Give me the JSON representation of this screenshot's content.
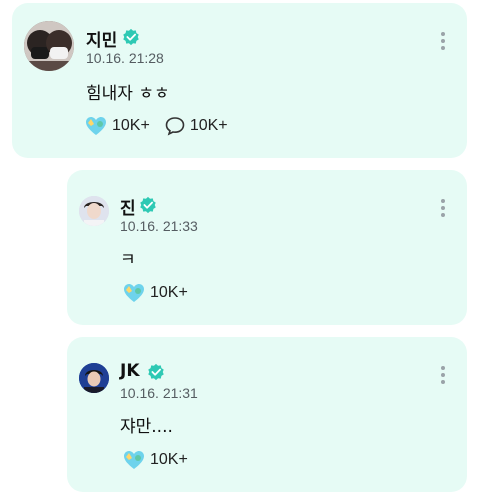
{
  "comments": [
    {
      "author": "지민",
      "time": "10.16. 21:28",
      "text": "힘내자 ㅎㅎ",
      "likes": "10K+",
      "replies": "10K+"
    },
    {
      "author": "진",
      "time": "10.16. 21:33",
      "text": "ㅋ",
      "likes": "10K+"
    },
    {
      "author": "JK",
      "time": "10.16. 21:31",
      "text": "쟈만....",
      "likes": "10K+"
    }
  ],
  "icons": {
    "verified": "verified-badge-icon",
    "like": "heart-sticker-icon",
    "reply": "speech-bubble-icon",
    "more": "vertical-dots-icon"
  },
  "colors": {
    "card_bg": "#e6fbf5",
    "verified": "#2ec9b4"
  }
}
